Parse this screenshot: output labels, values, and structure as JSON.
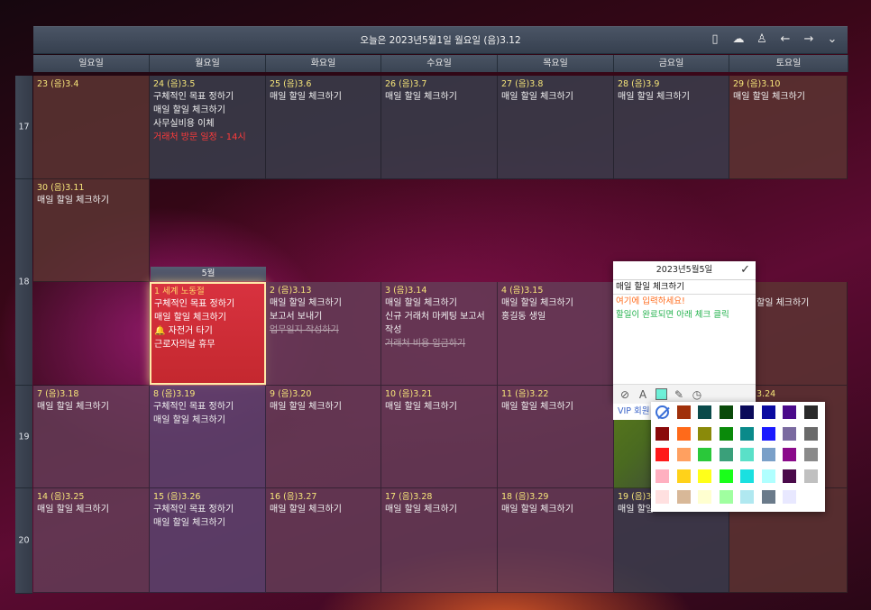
{
  "header": {
    "title": "오늘은 2023년5월1일 월요일 (음)3.12"
  },
  "header_icons": [
    "phone-icon",
    "cloud-check-icon",
    "user-icon",
    "arrow-left-icon",
    "arrow-right-icon",
    "chevron-down-icon"
  ],
  "days": [
    "일요일",
    "월요일",
    "화요일",
    "수요일",
    "목요일",
    "금요일",
    "토요일"
  ],
  "weeks": [
    "17",
    "18",
    "19",
    "20"
  ],
  "month_tab": "5월",
  "week17": {
    "sun": {
      "date": "23 (음)3.4"
    },
    "mon": {
      "date": "24 (음)3.5",
      "e1": "구체적인 목표 정하기",
      "e2": "매일 할일 체크하기",
      "e3": "사무실비용 이체",
      "e4": "거래처 방문 일정 - 14시"
    },
    "tue": {
      "date": "25 (음)3.6",
      "e1": "매일 할일 체크하기"
    },
    "wed": {
      "date": "26 (음)3.7",
      "e1": "매일 할일 체크하기"
    },
    "thu": {
      "date": "27 (음)3.8",
      "e1": "매일 할일 체크하기"
    },
    "fri": {
      "date": "28 (음)3.9",
      "e1": "매일 할일 체크하기"
    },
    "sat": {
      "date": "29 (음)3.10",
      "e1": "매일 할일 체크하기"
    }
  },
  "week18a": {
    "sun": {
      "date": "30 (음)3.11",
      "e1": "매일 할일 체크하기"
    }
  },
  "week18b": {
    "mon": {
      "date": "1 세계 노동절",
      "e1": "구체적인 목표 정하기",
      "e2": "매일 할일 체크하기",
      "e3": "🔔 자전거 타기",
      "e4": "근로자의날 휴무"
    },
    "tue": {
      "date": "2 (음)3.13",
      "e1": "매일 할일 체크하기",
      "e2": "보고서 보내기",
      "e3": "업무일지 작성하기"
    },
    "wed": {
      "date": "3 (음)3.14",
      "e1": "매일 할일 체크하기",
      "e2": "신규 거래처 마케팅 보고서",
      "e3": "작성",
      "e4": "거래처 비용 입금하기"
    },
    "thu": {
      "date": "4 (음)3.15",
      "e1": "매일 할일 체크하기",
      "e2": "홍길동 생일"
    },
    "sat": {
      "e1": "할일 체크하기"
    }
  },
  "week19": {
    "sun": {
      "date": "7 (음)3.18",
      "e1": "매일 할일 체크하기"
    },
    "mon": {
      "date": "8 (음)3.19",
      "e1": "구체적인 목표 정하기",
      "e2": "매일 할일 체크하기"
    },
    "tue": {
      "date": "9 (음)3.20",
      "e1": "매일 할일 체크하기"
    },
    "wed": {
      "date": "10 (음)3.21",
      "e1": "매일 할일 체크하기"
    },
    "thu": {
      "date": "11 (음)3.22",
      "e1": "매일 할일 체크하기"
    },
    "sat": {
      "date": "3.24"
    }
  },
  "week20": {
    "sun": {
      "date": "14 (음)3.25",
      "e1": "매일 할일 체크하기"
    },
    "mon": {
      "date": "15 (음)3.26",
      "e1": "구체적인 목표 정하기",
      "e2": "매일 할일 체크하기"
    },
    "tue": {
      "date": "16 (음)3.27",
      "e1": "매일 할일 체크하기"
    },
    "wed": {
      "date": "17 (음)3.28",
      "e1": "매일 할일 체크하기"
    },
    "thu": {
      "date": "18 (음)3.29",
      "e1": "매일 할일 체크하기"
    },
    "fri": {
      "date": "19 (음)3",
      "e1": "매일 할일"
    }
  },
  "editor": {
    "header": "2023년5월5일",
    "line1": "매일 할일 체크하기",
    "line2": "여기에 입력하세요!",
    "line3": "할일이 완료되면 아래 체크 클릭"
  },
  "editor_tools": [
    "check-circle-icon",
    "text-color-icon",
    "background-color-icon",
    "edit-note-icon",
    "clock-icon"
  ],
  "vip_label": "VIP 회원",
  "palette": {
    "rows": [
      [
        "none",
        "#a0300a",
        "#0a4a4a",
        "#0a4a0a",
        "#0a0a5a",
        "#0a0aa0",
        "#4a0a8a",
        "#2a2a2a"
      ],
      [
        "#8a0a0a",
        "#ff6a1a",
        "#8a8a0a",
        "#0a8a0a",
        "#0a8a8a",
        "#1a1aff",
        "#7a6aa0",
        "#6a6a6a"
      ],
      [
        "#ff1a1a",
        "#ffa060",
        "#2ac83a",
        "#3aa07a",
        "#5ae0c8",
        "#7aa0c8",
        "#8a0a8a",
        "#8a8a8a"
      ],
      [
        "#ffb0c0",
        "#ffd21a",
        "#ffff1a",
        "#1aff1a",
        "#1ae0e0",
        "#b0ffff",
        "#4a0a4a",
        "#c0c0c0"
      ],
      [
        "#ffe0e0",
        "#d8b898",
        "#ffffd0",
        "#a0ffa0",
        "#b0e8f0",
        "#6a7a8a",
        "#e8e8ff",
        "#ffffff"
      ]
    ]
  }
}
